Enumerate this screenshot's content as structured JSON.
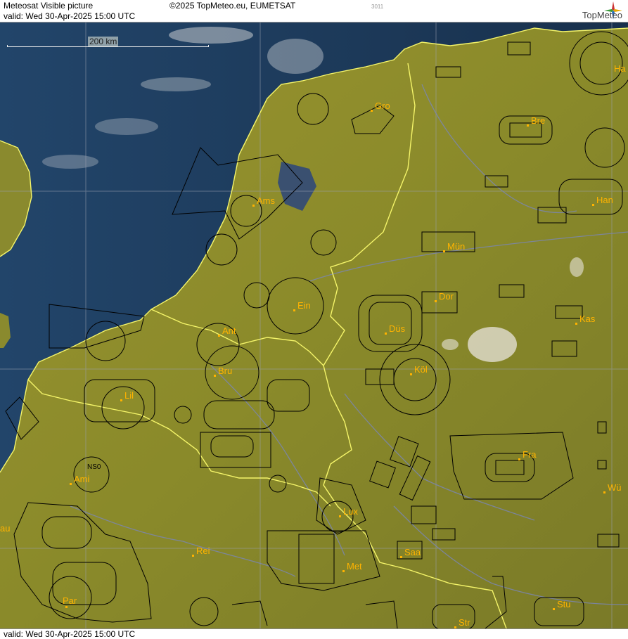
{
  "header": {
    "title": "Meteosat Visible picture",
    "copyright": "©2025 TopMeteo.eu, EUMETSAT",
    "valid": "valid:  Wed  30-Apr-2025  15:00 UTC",
    "code": "3011",
    "logo_text": "TopMeteo"
  },
  "scale": {
    "label": "200 km"
  },
  "footer": {
    "valid": "valid:  Wed  30-Apr-2025  15:00 UTC"
  },
  "cities": [
    {
      "name": "Gro"
    },
    {
      "name": "Bre"
    },
    {
      "name": "Ha"
    },
    {
      "name": "Ams"
    },
    {
      "name": "Han"
    },
    {
      "name": "Mün"
    },
    {
      "name": "Ein"
    },
    {
      "name": "Dor"
    },
    {
      "name": "Kas"
    },
    {
      "name": "Ant"
    },
    {
      "name": "Düs"
    },
    {
      "name": "Bru"
    },
    {
      "name": "Köl"
    },
    {
      "name": "Lil"
    },
    {
      "name": "Fra"
    },
    {
      "name": "Ami"
    },
    {
      "name": "Wü"
    },
    {
      "name": "Lux"
    },
    {
      "name": "Rei"
    },
    {
      "name": "Saa"
    },
    {
      "name": "Met"
    },
    {
      "name": "Par"
    },
    {
      "name": "Stu"
    },
    {
      "name": "Str"
    },
    {
      "name": "au"
    }
  ],
  "airfield_label": "NS0",
  "colors": {
    "sea": "#1d3a5c",
    "land": "#8a8a2a",
    "border": "#f5f56a",
    "city": "#ffb300"
  }
}
